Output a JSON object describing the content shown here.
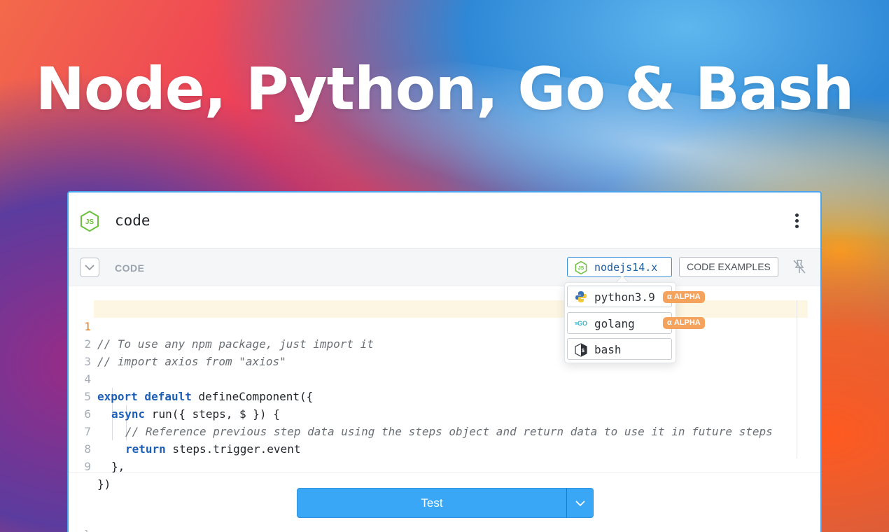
{
  "headline": "Node, Python, Go & Bash",
  "step": {
    "title": "code",
    "icon": "nodejs-icon"
  },
  "toolbar": {
    "section_label": "CODE",
    "runtime_selected": "nodejs14.x",
    "examples_label": "CODE EXAMPLES"
  },
  "runtime_options": [
    {
      "label": "python3.9",
      "icon": "python-icon",
      "badge": "α ALPHA"
    },
    {
      "label": "golang",
      "icon": "go-icon",
      "badge": "α ALPHA"
    },
    {
      "label": "bash",
      "icon": "bash-icon",
      "badge": ""
    }
  ],
  "code": {
    "active_line": 1,
    "lines": [
      {
        "num": "1",
        "text": "// To use any npm package, just import it"
      },
      {
        "num": "2",
        "text": "// import axios from \"axios\""
      },
      {
        "num": "3",
        "text": ""
      },
      {
        "num": "4",
        "kw": "export default",
        "text": " defineComponent({"
      },
      {
        "num": "5",
        "kw": "async",
        "text": " run({ steps, $ }) {"
      },
      {
        "num": "6",
        "text": "// Reference previous step data using the steps object and return data to use it in future steps"
      },
      {
        "num": "7",
        "kw": "return",
        "text": " steps.trigger.event"
      },
      {
        "num": "8",
        "text": "},"
      },
      {
        "num": "9",
        "text": "})"
      }
    ]
  },
  "footer": {
    "test_label": "Test",
    "trailing_snippet": "}"
  },
  "colors": {
    "accent": "#39a7f5",
    "alpha_badge": "#f5a35c",
    "keyword": "#1c5fb8",
    "active_line_number": "#e07a1a"
  }
}
